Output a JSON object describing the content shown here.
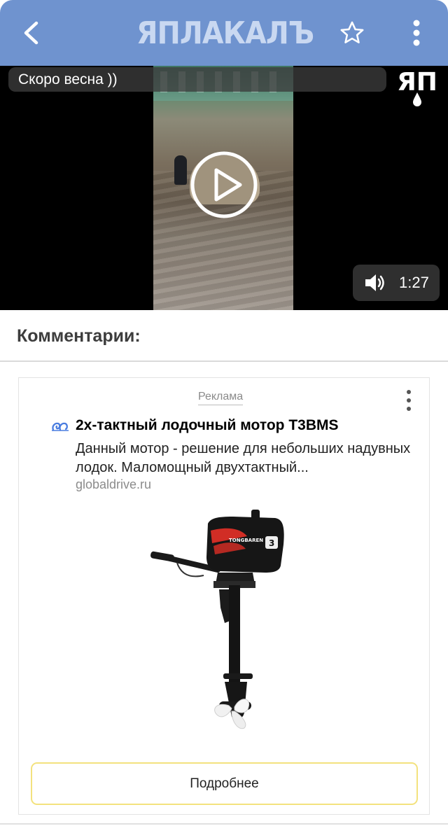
{
  "header": {
    "logo_text": "ЯПЛАКАЛЪ",
    "back_icon": "chevron-left-icon",
    "star_icon": "star-outline-icon",
    "more_icon": "more-vertical-icon",
    "background_color": "#6f93cf"
  },
  "video": {
    "caption": "Скоро весна ))",
    "watermark": "ЯП",
    "duration": "1:27",
    "play_icon": "play-icon",
    "volume_icon": "speaker-icon"
  },
  "comments": {
    "title": "Комментарии:"
  },
  "ad": {
    "label": "Реклама",
    "title": "2х-тактный лодочный мотор T3BMS",
    "text": "Данный мотор - решение для небольших надувных лодок. Маломощный двухтактный...",
    "domain": "globaldrive.ru",
    "image_brand": "TONGBAREN",
    "image_badge": "3",
    "button_label": "Подробнее",
    "button_border_color": "#f3e27e"
  }
}
